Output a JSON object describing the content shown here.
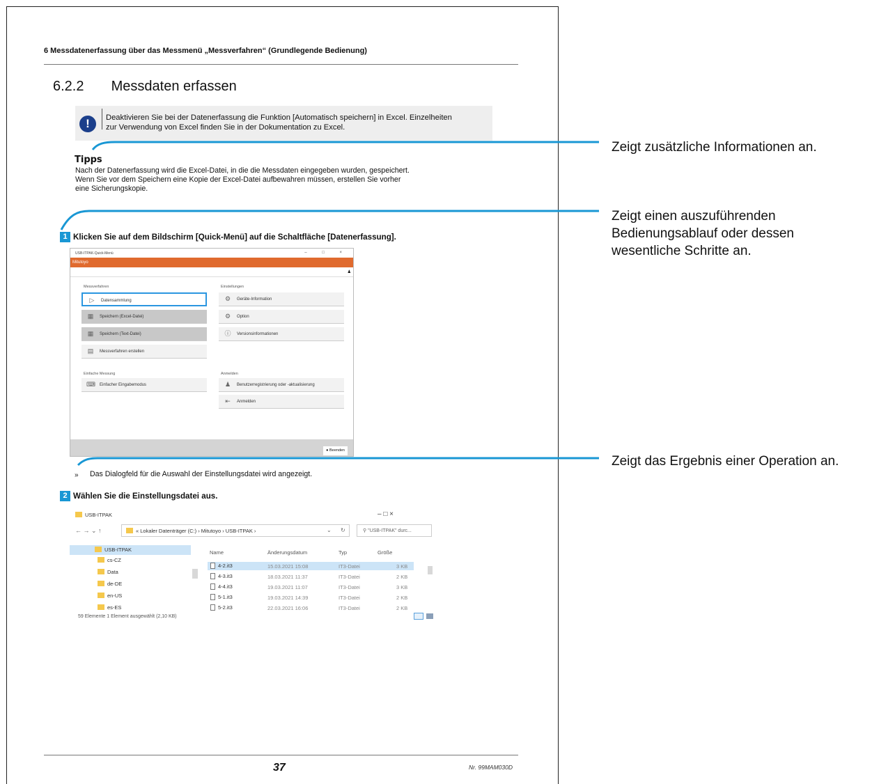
{
  "header": {
    "running_title": "6 Messdatenerfassung über das Messmenü „Messverfahren“ (Grundlegende Bedienung)"
  },
  "section": {
    "number": "6.2.2",
    "title": "Messdaten erfassen"
  },
  "note": {
    "icon": "exclamation-icon",
    "line1": "Deaktivieren Sie bei der Datenerfassung die Funktion [Automatisch speichern] in Excel. Einzelheiten",
    "line2": "zur Verwendung von Excel finden Sie in der Dokumentation zu Excel."
  },
  "tips": {
    "title": "Tipps",
    "line1": "Nach der Datenerfassung wird die Excel-Datei, in die die Messdaten eingegeben wurden, gespeichert.",
    "line2": "Wenn Sie vor dem Speichern eine Kopie der Excel-Datei aufbewahren müssen, erstellen Sie vorher",
    "line3": "eine Sicherungskopie."
  },
  "step1": {
    "number": "1",
    "text": "Klicken Sie auf dem Bildschirm [Quick-Menü] auf die Schaltfläche [Datenerfassung]."
  },
  "app": {
    "window_title": "USB-ITPAK-Quick-Menü",
    "window_controls": "– □ ×",
    "brand": "Mitutoyo",
    "user_icon": "user-icon",
    "group_measure": "Messverfahren",
    "group_settings": "Einstellungen",
    "group_simple": "Einfache Messung",
    "group_login": "Anmelden",
    "btn_collect": "Datensammlung",
    "btn_excel": "Speichern (Excel-Datei)",
    "btn_text": "Speichern (Text-Datei)",
    "btn_create": "Messverfahren erstellen",
    "btn_device": "Geräte-Information",
    "btn_option": "Option",
    "btn_version": "Versionsinformationen",
    "btn_simple": "Einfacher Eingabemodus",
    "btn_register": "Benutzerregistrierung oder -aktualisierung",
    "btn_login": "Anmelden",
    "btn_end": "Beenden"
  },
  "result": {
    "mark": "»",
    "text": "Das Dialogfeld für die Auswahl der Einstellungsdatei wird angezeigt."
  },
  "step2": {
    "number": "2",
    "text": "Wählen Sie die Einstellungsdatei aus."
  },
  "explorer": {
    "title": "USB-ITPAK",
    "window_controls": "–      □      ×",
    "nav": "←   →   ⌄   ↑",
    "address": "«  Lokaler Datenträger (C:)  ›  Mitutoyo  ›  USB-ITPAK  ›",
    "search_placeholder": "\"USB-ITPAK\" durc...",
    "tree": [
      "USB-ITPAK",
      "cs-CZ",
      "Data",
      "de-DE",
      "en-US",
      "es-ES"
    ],
    "columns": {
      "name": "Name",
      "date": "Änderungsdatum",
      "type": "Typ",
      "size": "Größe"
    },
    "files": [
      {
        "name": "4-2.it3",
        "date": "15.03.2021 15:08",
        "type": "IT3-Datei",
        "size": "3 KB"
      },
      {
        "name": "4-3.it3",
        "date": "18.03.2021 11:37",
        "type": "IT3-Datei",
        "size": "2 KB"
      },
      {
        "name": "4-4.it3",
        "date": "19.03.2021 11:07",
        "type": "IT3-Datei",
        "size": "3 KB"
      },
      {
        "name": "5-1.it3",
        "date": "19.03.2021 14:39",
        "type": "IT3-Datei",
        "size": "2 KB"
      },
      {
        "name": "5-2.it3",
        "date": "22.03.2021 16:06",
        "type": "IT3-Datei",
        "size": "2 KB"
      },
      {
        "name": "5-4.it3",
        "date": "22.03.2021 13:20",
        "type": "IT3-Datei",
        "size": "2 KB"
      }
    ],
    "status": "59 Elemente     1 Element ausgewählt (2,10 KB)"
  },
  "callouts": {
    "c1": "Zeigt zusätzliche Informationen an.",
    "c2_line1": "Zeigt einen auszuführenden",
    "c2_line2": "Bedienungsablauf oder dessen",
    "c2_line3": "wesentliche Schritte an.",
    "c3": "Zeigt das Ergebnis einer Operation an."
  },
  "footer": {
    "page_number": "37",
    "doc_number": "Nr. 99MAM030D"
  },
  "colors": {
    "accent": "#1997d4",
    "brand_orange": "#e06a2e",
    "note_icon": "#1b3f8b"
  }
}
